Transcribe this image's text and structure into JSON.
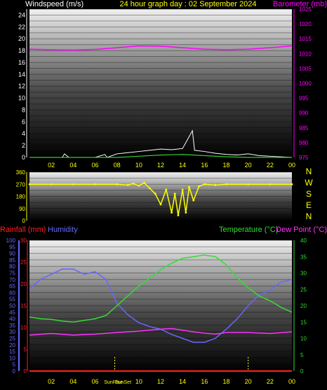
{
  "colors": {
    "wind": "#ffffff",
    "gust": "#ffffff",
    "avg_wind": "#33cc33",
    "barometer": "#ff00ff",
    "direction": "#ffff00",
    "rainfall": "#ff2020",
    "humidity": "#6666ff",
    "temperature": "#33dd33",
    "dew_point": "#ff33ff",
    "sun_marker": "#ffff00",
    "hour_labels": "#ffff00"
  },
  "chart_data": [
    {
      "type": "line",
      "title": "24 hour graph day : 02 September 2024",
      "ylabel": "Windspeed (m/s)",
      "y2label": "Barometer (mb)",
      "ylim": [
        0,
        25
      ],
      "y2lim": [
        975,
        1025
      ],
      "yticks": [
        0,
        2,
        4,
        6,
        8,
        10,
        12,
        14,
        16,
        18,
        20,
        22,
        24
      ],
      "y2ticks": [
        975,
        980,
        985,
        990,
        995,
        1000,
        1005,
        1010,
        1015,
        1020,
        1025
      ],
      "xticks": [
        "02",
        "04",
        "06",
        "08",
        "10",
        "12",
        "14",
        "16",
        "18",
        "20",
        "22",
        "00"
      ],
      "series": [
        {
          "axis": "right",
          "x": [
            0,
            2,
            4,
            6,
            8,
            10,
            12,
            14,
            16,
            18,
            20,
            22,
            24
          ],
          "values": [
            1011.5,
            1011.3,
            1011.2,
            1011.4,
            1012.0,
            1012.6,
            1012.5,
            1012.0,
            1011.5,
            1011.3,
            1011.5,
            1012.0,
            1012.6
          ]
        },
        {
          "axis": "left",
          "x": [
            0,
            3,
            3.2,
            3.6,
            6,
            6.9,
            7.1,
            8,
            9,
            10,
            11,
            12,
            13,
            14,
            14.9,
            15.1,
            16,
            17,
            18,
            19,
            20,
            21,
            22,
            24
          ],
          "values": [
            0,
            0,
            0.6,
            0,
            0,
            0.5,
            0,
            0.6,
            0.8,
            1.0,
            1.2,
            1.4,
            1.3,
            1.5,
            4.5,
            1.2,
            1.0,
            0.7,
            0.5,
            0.4,
            0.6,
            0.3,
            0.2,
            0
          ]
        },
        {
          "axis": "left",
          "x": [
            0,
            8,
            10,
            12,
            14,
            16,
            18,
            20,
            24
          ],
          "values": [
            0,
            0,
            0.2,
            0.4,
            0.5,
            0.3,
            0.1,
            0,
            0
          ]
        }
      ]
    },
    {
      "type": "scatter",
      "ylim": [
        0,
        360
      ],
      "yticks": [
        0,
        90,
        180,
        270,
        360
      ],
      "compass": [
        "N",
        "W",
        "S",
        "E",
        "N"
      ],
      "series": [
        {
          "x": [
            0,
            2,
            4,
            6,
            8,
            9,
            9.5,
            10,
            10.5,
            11,
            11.5,
            12,
            12.5,
            13,
            13.3,
            13.6,
            14,
            14.3,
            14.6,
            15,
            15.5,
            16,
            17,
            18,
            20,
            22,
            24
          ],
          "values": [
            270,
            270,
            270,
            270,
            270,
            265,
            275,
            260,
            280,
            240,
            200,
            120,
            230,
            60,
            200,
            40,
            230,
            60,
            250,
            150,
            255,
            270,
            265,
            270,
            270,
            270,
            270
          ]
        }
      ]
    },
    {
      "type": "line",
      "ylabel": "Rainfall (mm)",
      "ylabel2": "Humidity",
      "y2label": "Temperature (°C)",
      "y2label2": "Dew Point (°C)",
      "ylim": [
        0,
        100
      ],
      "yticks": [
        0,
        5,
        10,
        15,
        20,
        25,
        30,
        35,
        40,
        45,
        50,
        55,
        60,
        65,
        70,
        75,
        80,
        85,
        90,
        95,
        100
      ],
      "rain_ticks": [
        0,
        5,
        10,
        15,
        20,
        25,
        30
      ],
      "y2lim": [
        0,
        40
      ],
      "y2ticks": [
        0,
        5,
        10,
        15,
        20,
        25,
        30,
        35,
        40
      ],
      "xticks": [
        "02",
        "04",
        "06",
        "08",
        "10",
        "12",
        "14",
        "16",
        "18",
        "20",
        "22",
        "00"
      ],
      "sunrise_label": "SunRise",
      "sunset_label": "SunSet",
      "sunrise_x": 7.8,
      "sunset_x": 20.0,
      "series": [
        {
          "x": [
            0,
            1,
            2,
            3,
            4,
            5,
            6,
            7,
            8,
            9,
            10,
            11,
            12,
            13,
            14,
            15,
            16,
            17,
            18,
            19,
            20,
            21,
            22,
            23,
            24
          ],
          "values": [
            63,
            70,
            74,
            78,
            78,
            74,
            76,
            70,
            52,
            43,
            37,
            34,
            32,
            28,
            25,
            22,
            22,
            25,
            32,
            40,
            50,
            58,
            62,
            68,
            70
          ]
        },
        {
          "x": [
            0,
            1,
            2,
            3,
            4,
            5,
            6,
            7,
            8,
            9,
            10,
            11,
            12,
            13,
            14,
            15,
            16,
            17,
            18,
            19,
            20,
            21,
            22,
            23,
            24
          ],
          "values": [
            16.5,
            16.0,
            15.8,
            15.3,
            15.0,
            15.5,
            16.0,
            17.0,
            20.0,
            23.0,
            26.0,
            28.5,
            31.0,
            33.0,
            34.5,
            35.0,
            35.5,
            35.0,
            32.5,
            28.5,
            25.5,
            23.0,
            21.5,
            19.5,
            18.0
          ]
        },
        {
          "x": [
            0,
            2,
            4,
            6,
            8,
            10,
            11,
            12,
            13,
            14,
            15,
            16,
            17,
            18,
            20,
            22,
            24
          ],
          "values": [
            11.0,
            11.5,
            11.0,
            11.3,
            11.8,
            12.2,
            12.5,
            12.8,
            13.0,
            12.5,
            12.0,
            11.6,
            11.3,
            11.8,
            11.8,
            11.5,
            12.0
          ]
        },
        {
          "x": [
            0,
            24
          ],
          "values": [
            0,
            0
          ]
        }
      ]
    }
  ]
}
